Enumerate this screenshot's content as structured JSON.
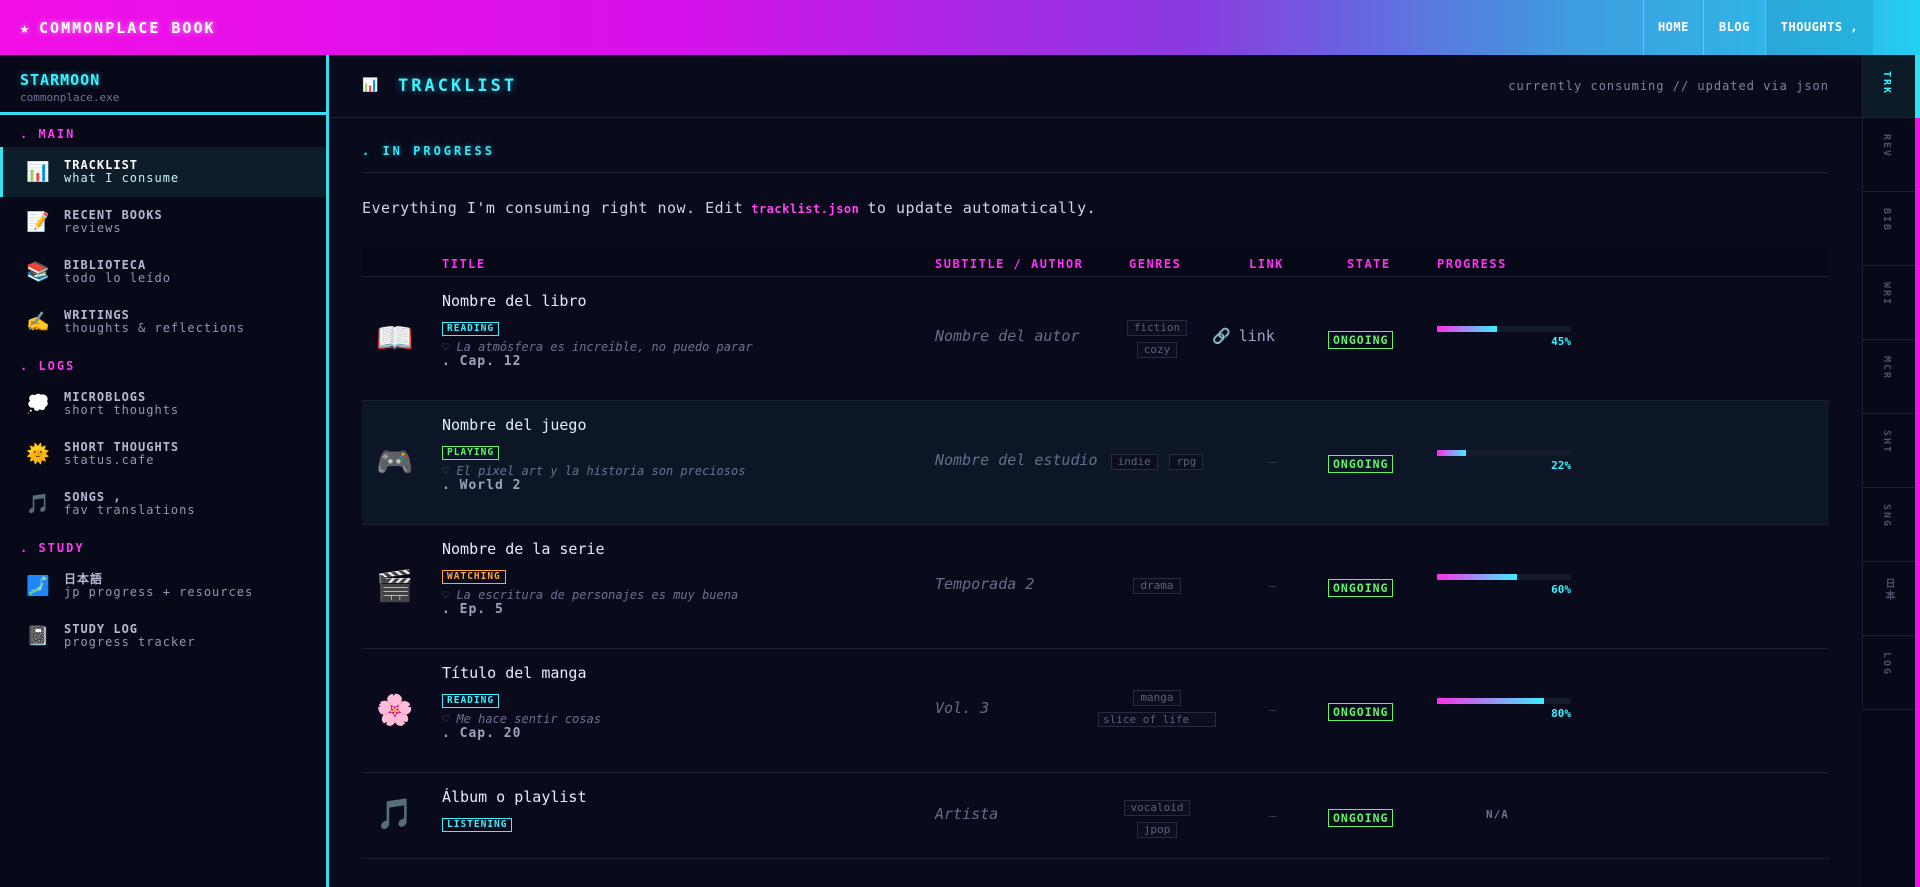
{
  "topbar": {
    "brand": "COMMONPLACE BOOK",
    "brand_icon": "★",
    "nav": [
      {
        "label": "HOME"
      },
      {
        "label": "BLOG"
      },
      {
        "label": "THOUGHTS ,"
      }
    ]
  },
  "sidebar": {
    "profile_name": "STARMOON",
    "profile_sub": "commonplace.exe",
    "sections": [
      {
        "title": ". MAIN",
        "items": [
          {
            "icon": "📊",
            "label": "TRACKLIST",
            "sub": "what I consume",
            "active": true
          },
          {
            "icon": "📝",
            "label": "RECENT BOOKS",
            "sub": "reviews"
          },
          {
            "icon": "📚",
            "label": "BIBLIOTECA",
            "sub": "todo lo leído"
          },
          {
            "icon": "✍️",
            "label": "WRITINGS",
            "sub": "thoughts & reflections"
          }
        ]
      },
      {
        "title": ". LOGS",
        "items": [
          {
            "icon": "💭",
            "label": "MICROBLOGS",
            "sub": "short thoughts"
          },
          {
            "icon": "🌞",
            "label": "SHORT THOUGHTS",
            "sub": "status.cafe"
          },
          {
            "icon": "🎵",
            "label": "SONGS ,",
            "sub": "fav translations"
          }
        ]
      },
      {
        "title": ". STUDY",
        "items": [
          {
            "icon": "🗾",
            "label": "日本語",
            "sub": "jp progress + resources"
          },
          {
            "icon": "📓",
            "label": "STUDY LOG",
            "sub": "progress tracker"
          }
        ]
      }
    ]
  },
  "header": {
    "icon": "📊",
    "title": "TRACKLIST",
    "meta": "currently consuming // updated via json"
  },
  "section": {
    "title": ". IN PROGRESS",
    "intro_before": "Everything I'm consuming right now. Edit",
    "intro_code": "tracklist.json",
    "intro_after": "to update automatically."
  },
  "table": {
    "columns": [
      "TITLE",
      "SUBTITLE / AUTHOR",
      "GENRES",
      "LINK",
      "STATE",
      "PROGRESS"
    ],
    "rows": [
      {
        "icon": "📖",
        "title": "Nombre del libro",
        "badge": "READING",
        "badge_type": "reading",
        "note": "♡ La atmósfera es increíble, no puedo parar",
        "progress_note": ". Cap. 12",
        "author": "Nombre del autor",
        "genres": [
          "fiction",
          "cozy"
        ],
        "link_icon": "🔗",
        "link": "link",
        "state": "ONGOING",
        "progress": 45,
        "progress_label": "45%"
      },
      {
        "icon": "🎮",
        "title": "Nombre del juego",
        "badge": "PLAYING",
        "badge_type": "playing",
        "note": "♡ El pixel art y la historia son preciosos",
        "progress_note": ". World 2",
        "author": "Nombre del estudio",
        "genres": [
          "indie",
          "rpg"
        ],
        "link": "—",
        "state": "ONGOING",
        "progress": 22,
        "progress_label": "22%"
      },
      {
        "icon": "🎬",
        "title": "Nombre de la serie",
        "badge": "WATCHING",
        "badge_type": "watching",
        "note": "♡ La escritura de personajes es muy buena",
        "progress_note": ". Ep. 5",
        "author": "Temporada 2",
        "genres": [
          "drama"
        ],
        "link": "—",
        "state": "ONGOING",
        "progress": 60,
        "progress_label": "60%"
      },
      {
        "icon": "🌸",
        "title": "Título del manga",
        "badge": "READING",
        "badge_type": "reading",
        "note": "♡ Me hace sentir cosas",
        "progress_note": ". Cap. 20",
        "author": "Vol. 3",
        "genres": [
          "manga",
          "slice of life"
        ],
        "link": "—",
        "state": "ONGOING",
        "progress": 80,
        "progress_label": "80%"
      },
      {
        "icon": "🎵",
        "title": "Álbum o playlist",
        "badge": "LISTENING",
        "badge_type": "listening",
        "author": "Artista",
        "genres": [
          "vocaloid",
          "jpop"
        ],
        "link": "—",
        "state": "ONGOING",
        "progress_label": "N/A"
      }
    ]
  },
  "right_tabs": [
    "TRK",
    "REV",
    "BIB",
    "WRI",
    "MCR",
    "SHT",
    "SNG",
    "日本",
    "LOG"
  ],
  "colors": {
    "accent_cyan": "#3df1ff",
    "accent_magenta": "#ff30f0",
    "state_green": "#63f26a",
    "watching_orange": "#ffa53a"
  }
}
